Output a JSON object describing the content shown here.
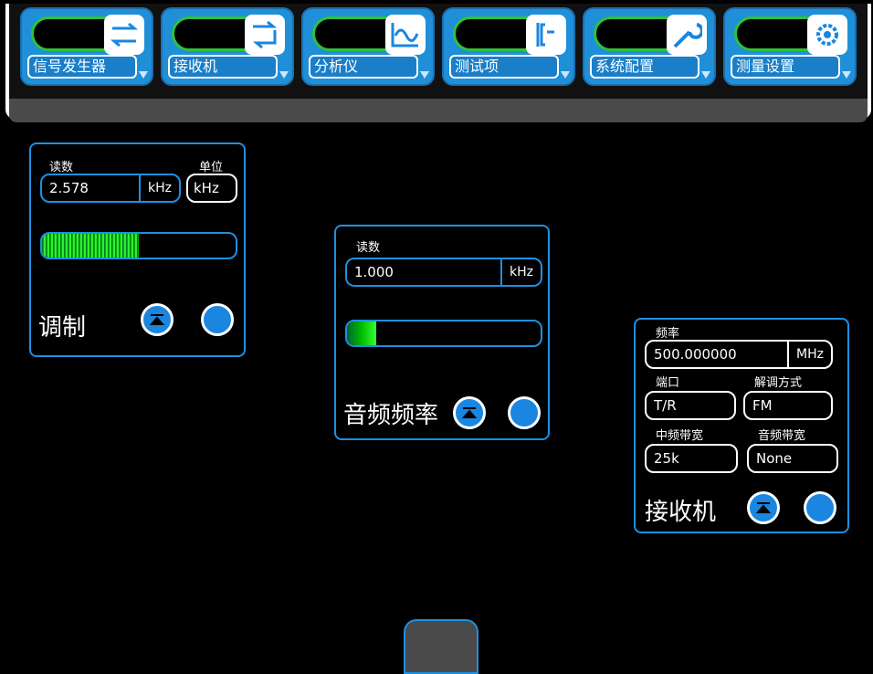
{
  "menu": {
    "items": [
      {
        "label": "信号发生器",
        "icon": "swap-arrows-icon"
      },
      {
        "label": "接收机",
        "icon": "return-arrows-icon"
      },
      {
        "label": "分析仪",
        "icon": "waveform-icon"
      },
      {
        "label": "测试项",
        "icon": "test-bracket-icon"
      },
      {
        "label": "系统配置",
        "icon": "wrench-icon"
      },
      {
        "label": "测量设置",
        "icon": "gear-icon"
      }
    ]
  },
  "modulation_panel": {
    "reading_label": "读数",
    "reading_value": "2.578",
    "reading_unit": "kHz",
    "unit_label": "单位",
    "unit_value": "kHz",
    "bar_fill": 0.5,
    "title": "调制"
  },
  "audio_panel": {
    "reading_label": "读数",
    "reading_value": "1.000",
    "reading_unit": "kHz",
    "bar_fill": 0.15,
    "title": "音频频率"
  },
  "receiver_panel": {
    "freq_label": "频率",
    "freq_value": "500.000000",
    "freq_unit": "MHz",
    "port_label": "端口",
    "port_value": "T/R",
    "demod_label": "解调方式",
    "demod_value": "FM",
    "if_bw_label": "中频带宽",
    "if_bw_value": "25k",
    "audio_bw_label": "音频带宽",
    "audio_bw_value": "None",
    "title": "接收机"
  },
  "colors": {
    "accent": "#1e90e0",
    "green": "#2ec23a"
  }
}
